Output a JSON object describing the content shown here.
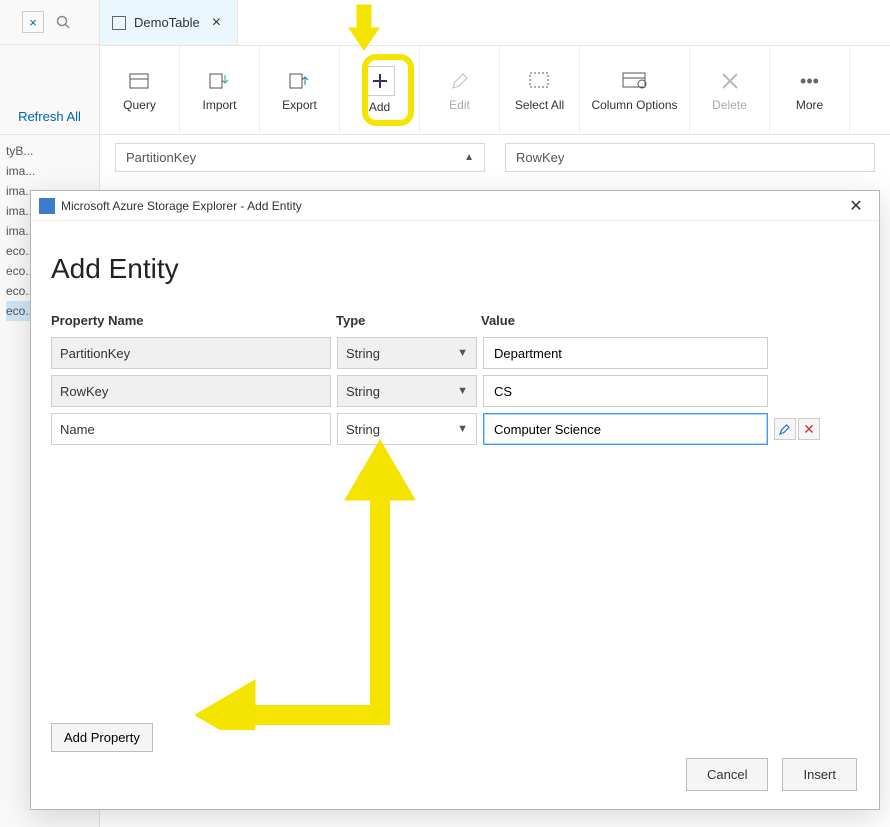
{
  "left": {
    "refresh_label": "Refresh All",
    "tree": [
      "tyB...",
      "ima...",
      "ima...",
      "ima...",
      "ima...",
      "eco...",
      "eco...",
      "eco...",
      "eco..."
    ]
  },
  "tab": {
    "title": "DemoTable"
  },
  "toolbar": {
    "query": "Query",
    "import": "Import",
    "export": "Export",
    "add": "Add",
    "edit": "Edit",
    "select_all": "Select All",
    "column_options": "Column Options",
    "delete": "Delete",
    "more": "More"
  },
  "headers": {
    "partition": "PartitionKey",
    "rowkey": "RowKey"
  },
  "dialog": {
    "window_title": "Microsoft Azure Storage Explorer - Add Entity",
    "heading": "Add Entity",
    "col_property": "Property Name",
    "col_type": "Type",
    "col_value": "Value",
    "rows": [
      {
        "name": "PartitionKey",
        "type": "String",
        "value": "Department",
        "locked": true
      },
      {
        "name": "RowKey",
        "type": "String",
        "value": "CS",
        "locked": true
      },
      {
        "name": "Name",
        "type": "String",
        "value": "Computer Science",
        "locked": false,
        "focused": true
      }
    ],
    "add_property_label": "Add Property",
    "cancel": "Cancel",
    "insert": "Insert"
  }
}
